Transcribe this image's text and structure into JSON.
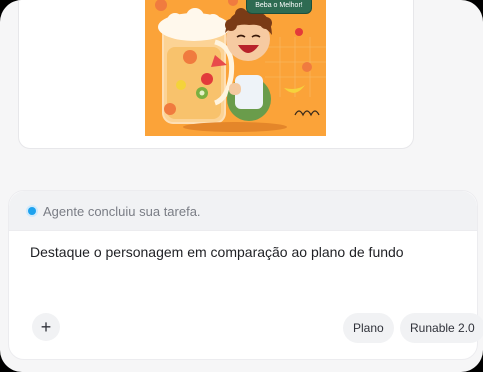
{
  "image": {
    "bubble_text": "Beba o Melhor!"
  },
  "status": {
    "text": "Agente concluiu sua tarefa."
  },
  "composer": {
    "prompt_text": "Destaque o personagem em comparação ao plano de fundo",
    "plus_label": "+",
    "plan_label": "Plano",
    "model_label": "Runable 2.0"
  },
  "colors": {
    "status_dot": "#1ea2ee",
    "art_background": "#fba339"
  }
}
